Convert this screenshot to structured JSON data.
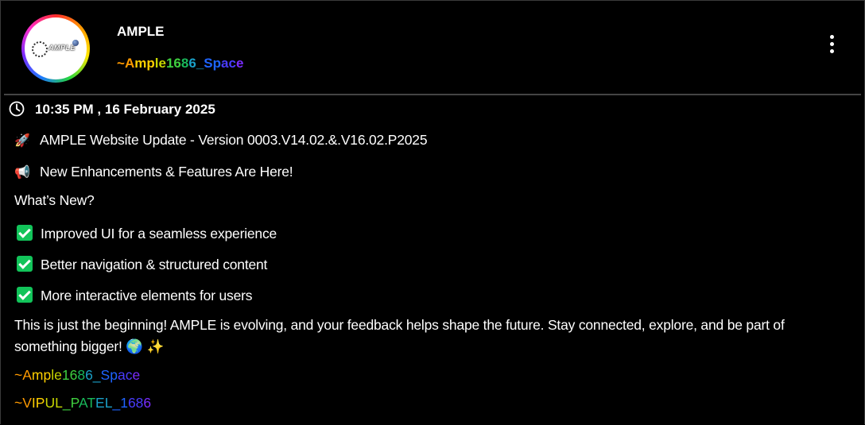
{
  "header": {
    "logo_text": "AMPLE",
    "title": "AMPLE",
    "handle": "~Ample1686_Space",
    "handle_colors": [
      "#ff9a00",
      "#ffd000",
      "#c8d600",
      "#3fcf3f",
      "#19b85a",
      "#1aa0c8",
      "#1e64ff",
      "#4a3cff",
      "#7a2cff"
    ]
  },
  "post": {
    "datetime": "10:35 PM , 16 February 2025",
    "update_line": "AMPLE Website Update - Version 0003.V14.02.&.V16.02.P2025",
    "update_icon": "rocket-icon",
    "announce_line": "New Enhancements & Features Are Here!",
    "announce_icon": "megaphone-icon",
    "whats_new": "What’s New?",
    "features": [
      "Improved UI for a seamless experience",
      "Better navigation & structured content",
      "More interactive elements for users"
    ],
    "feature_icon": "check-icon",
    "paragraph": "This is just the beginning! AMPLE is evolving, and your feedback helps shape the future. Stay connected, explore, and be part of something bigger!",
    "paragraph_icons": [
      "globe-icon",
      "sparkles-icon"
    ],
    "signature1": "~Ample1686_Space",
    "signature2": "~VIPUL_PATEL_1686"
  },
  "colors": {
    "background": "#000000",
    "check": "#12c45a",
    "divider": "#444444"
  }
}
